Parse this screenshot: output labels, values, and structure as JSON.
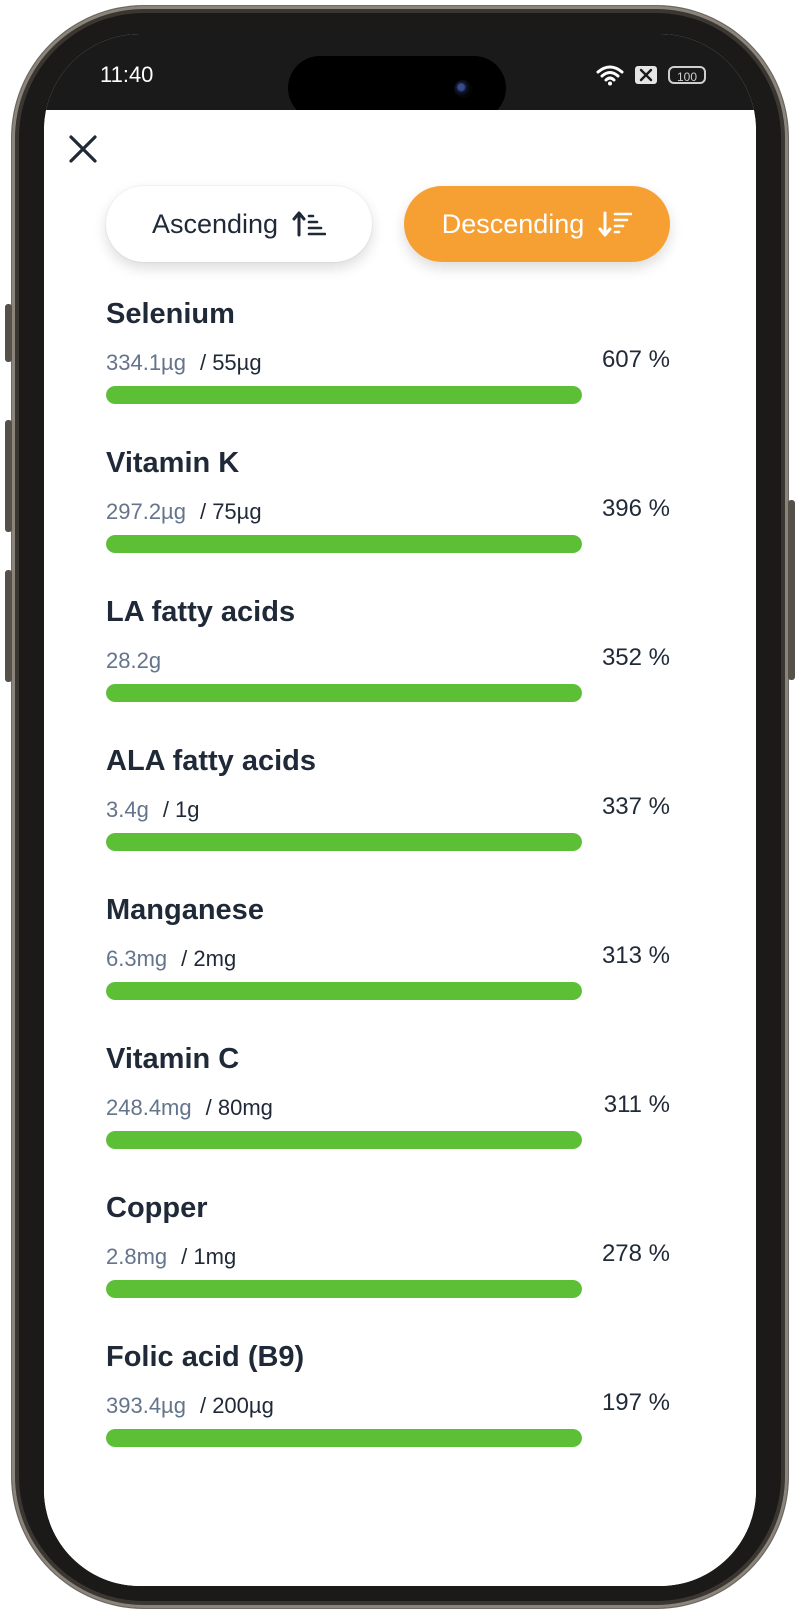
{
  "status_bar": {
    "time": "11:40",
    "battery": "100"
  },
  "sort": {
    "ascending_label": "Ascending",
    "descending_label": "Descending",
    "active": "descending",
    "active_color": "#f6a033"
  },
  "bar_color": "#5dbf36",
  "nutrients": [
    {
      "name": "Selenium",
      "amount": "334.1µg",
      "target": "/ 55µg",
      "percent": "607 %",
      "fill": 1.0
    },
    {
      "name": "Vitamin K",
      "amount": "297.2µg",
      "target": "/ 75µg",
      "percent": "396 %",
      "fill": 1.0
    },
    {
      "name": "LA fatty acids",
      "amount": "28.2g",
      "target": "",
      "percent": "352 %",
      "fill": 1.0
    },
    {
      "name": "ALA fatty acids",
      "amount": "3.4g",
      "target": "/ 1g",
      "percent": "337 %",
      "fill": 1.0
    },
    {
      "name": "Manganese",
      "amount": "6.3mg",
      "target": "/ 2mg",
      "percent": "313 %",
      "fill": 1.0
    },
    {
      "name": "Vitamin C",
      "amount": "248.4mg",
      "target": "/ 80mg",
      "percent": "311 %",
      "fill": 1.0
    },
    {
      "name": "Copper",
      "amount": "2.8mg",
      "target": "/ 1mg",
      "percent": "278 %",
      "fill": 1.0
    },
    {
      "name": "Folic acid (B9)",
      "amount": "393.4µg",
      "target": "/ 200µg",
      "percent": "197 %",
      "fill": 1.0
    }
  ]
}
